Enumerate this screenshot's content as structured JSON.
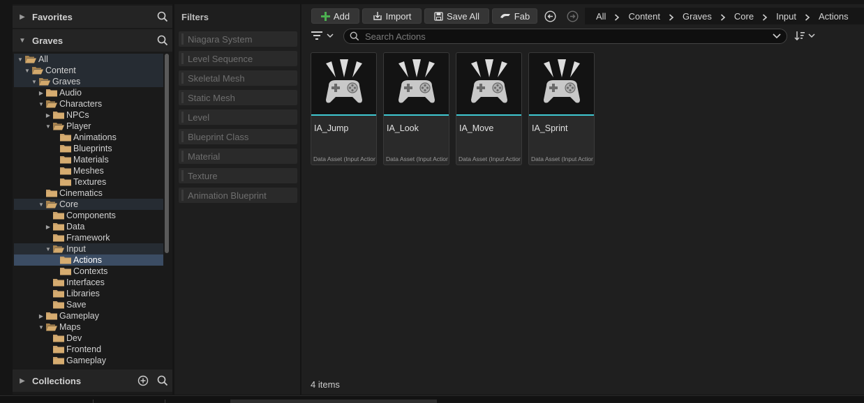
{
  "sources": {
    "favorites_label": "Favorites",
    "graves_label": "Graves",
    "collections_label": "Collections",
    "tree": [
      {
        "label": "All",
        "depth": 0,
        "expanded": true,
        "state": "hl"
      },
      {
        "label": "Content",
        "depth": 1,
        "expanded": true,
        "state": "hl"
      },
      {
        "label": "Graves",
        "depth": 2,
        "expanded": true,
        "state": "hl"
      },
      {
        "label": "Audio",
        "depth": 3,
        "expanded": false
      },
      {
        "label": "Characters",
        "depth": 3,
        "expanded": true
      },
      {
        "label": "NPCs",
        "depth": 4,
        "expanded": false
      },
      {
        "label": "Player",
        "depth": 4,
        "expanded": true
      },
      {
        "label": "Animations",
        "depth": 5
      },
      {
        "label": "Blueprints",
        "depth": 5
      },
      {
        "label": "Materials",
        "depth": 5
      },
      {
        "label": "Meshes",
        "depth": 5
      },
      {
        "label": "Textures",
        "depth": 5
      },
      {
        "label": "Cinematics",
        "depth": 3
      },
      {
        "label": "Core",
        "depth": 3,
        "expanded": true,
        "state": "hl"
      },
      {
        "label": "Components",
        "depth": 4
      },
      {
        "label": "Data",
        "depth": 4,
        "expanded": false
      },
      {
        "label": "Framework",
        "depth": 4
      },
      {
        "label": "Input",
        "depth": 4,
        "expanded": true,
        "state": "hl"
      },
      {
        "label": "Actions",
        "depth": 5,
        "state": "sel"
      },
      {
        "label": "Contexts",
        "depth": 5
      },
      {
        "label": "Interfaces",
        "depth": 4
      },
      {
        "label": "Libraries",
        "depth": 4
      },
      {
        "label": "Save",
        "depth": 4
      },
      {
        "label": "Gameplay",
        "depth": 3,
        "expanded": false
      },
      {
        "label": "Maps",
        "depth": 3,
        "expanded": true
      },
      {
        "label": "Dev",
        "depth": 4
      },
      {
        "label": "Frontend",
        "depth": 4
      },
      {
        "label": "Gameplay",
        "depth": 4
      }
    ]
  },
  "filters": {
    "title": "Filters",
    "items": [
      "Niagara System",
      "Level Sequence",
      "Skeletal Mesh",
      "Static Mesh",
      "Level",
      "Blueprint Class",
      "Material",
      "Texture",
      "Animation Blueprint"
    ]
  },
  "toolbar": {
    "add_label": "Add",
    "import_label": "Import",
    "save_all_label": "Save All",
    "fab_label": "Fab"
  },
  "breadcrumb": [
    "All",
    "Content",
    "Graves",
    "Core",
    "Input",
    "Actions"
  ],
  "search": {
    "placeholder": "Search Actions"
  },
  "assets": [
    {
      "name": "IA_Jump",
      "type": "Data Asset (Input Action)"
    },
    {
      "name": "IA_Look",
      "type": "Data Asset (Input Action)"
    },
    {
      "name": "IA_Move",
      "type": "Data Asset (Input Action)"
    },
    {
      "name": "IA_Sprint",
      "type": "Data Asset (Input Action)"
    }
  ],
  "status": {
    "item_count": "4 items"
  },
  "colors": {
    "accent_cyan": "#3fc8d2",
    "folder": "#c8a06a",
    "selection": "#3b4c63",
    "add_green": "#4caf50"
  }
}
